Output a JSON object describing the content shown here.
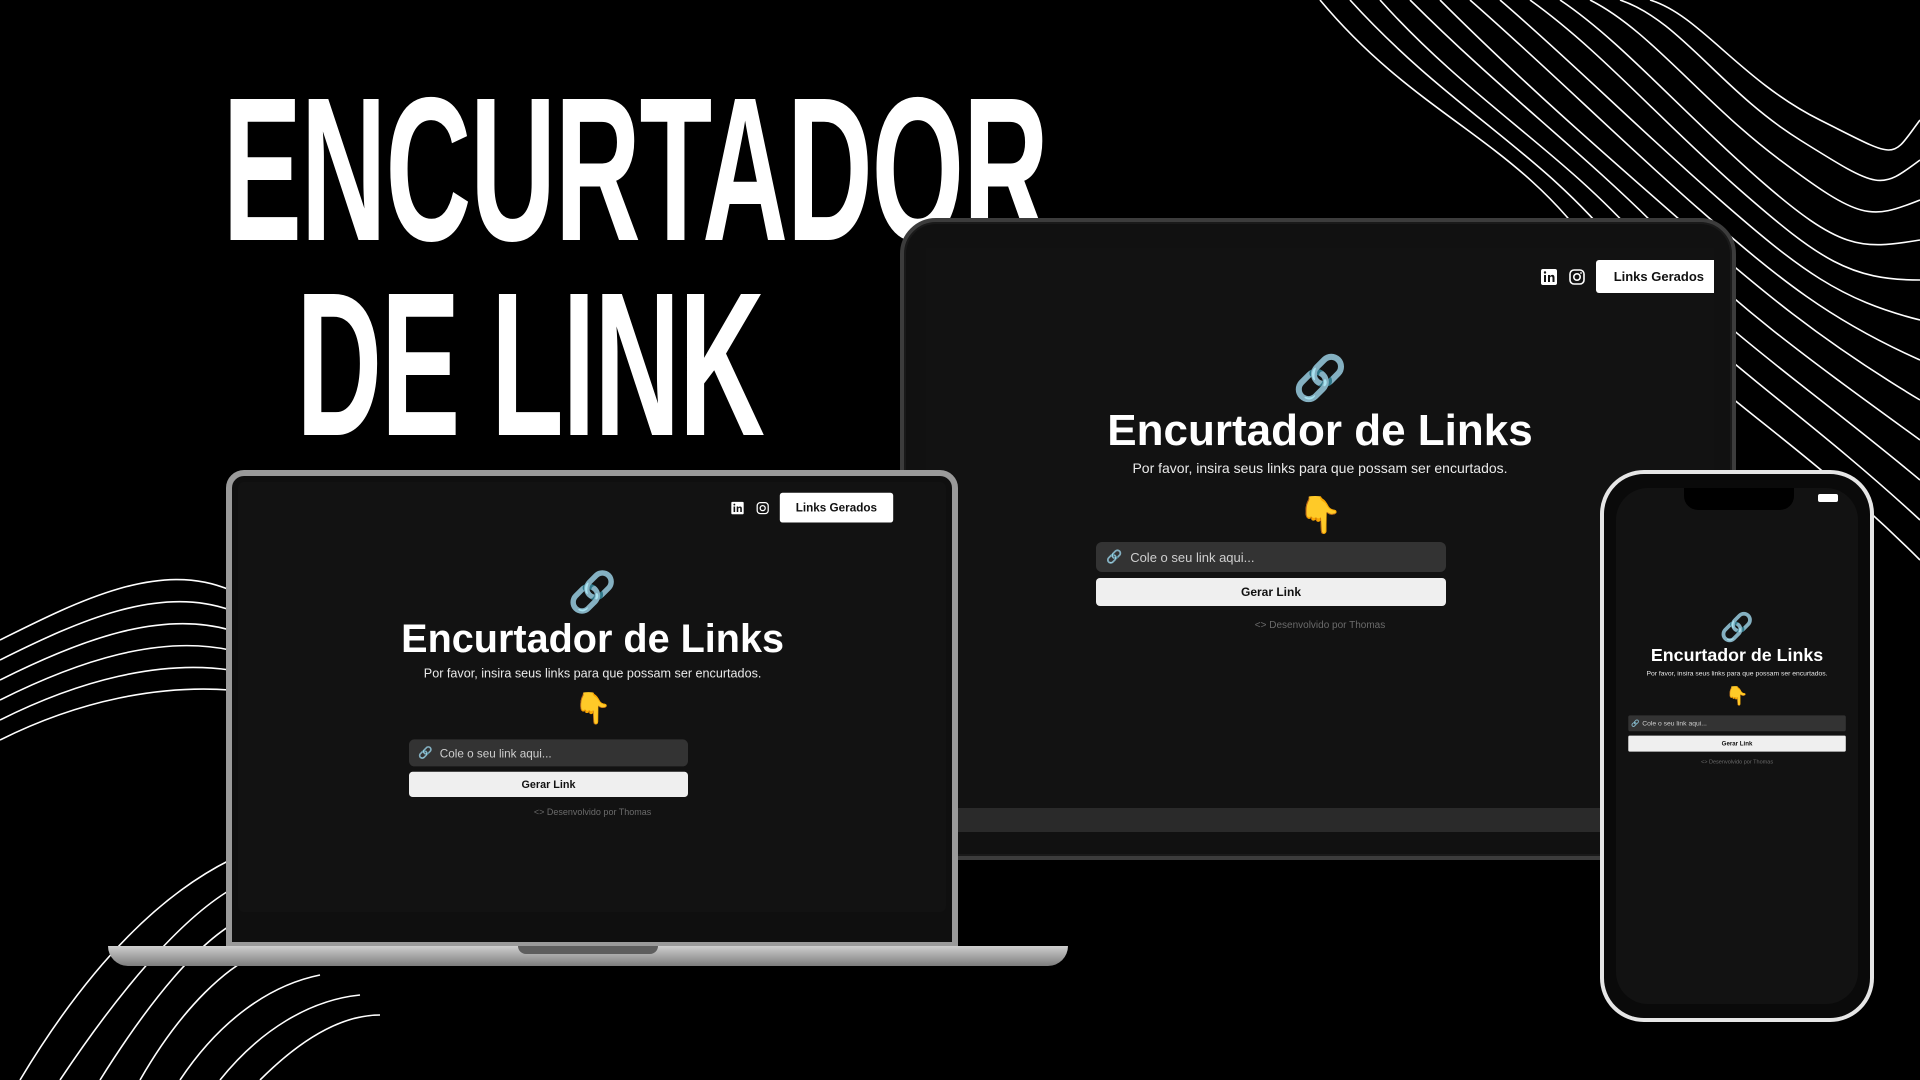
{
  "headline": {
    "line1": "ENCURTADOR",
    "line2": "DE LINK"
  },
  "app": {
    "top_button": "Links Gerados",
    "icons": [
      "linkedin-icon",
      "instagram-icon"
    ],
    "hero_icon": "🔗",
    "title": "Encurtador de Links",
    "subtitle": "Por favor, insira seus links para que possam ser encurtados.",
    "pointer_icon": "👇",
    "input_placeholder": "Cole o seu link aqui...",
    "submit_label": "Gerar Link",
    "credit": "<> Desenvolvido por Thomas"
  },
  "colors": {
    "background": "#000000",
    "screen": "#121212",
    "accent": "#ffffff"
  }
}
